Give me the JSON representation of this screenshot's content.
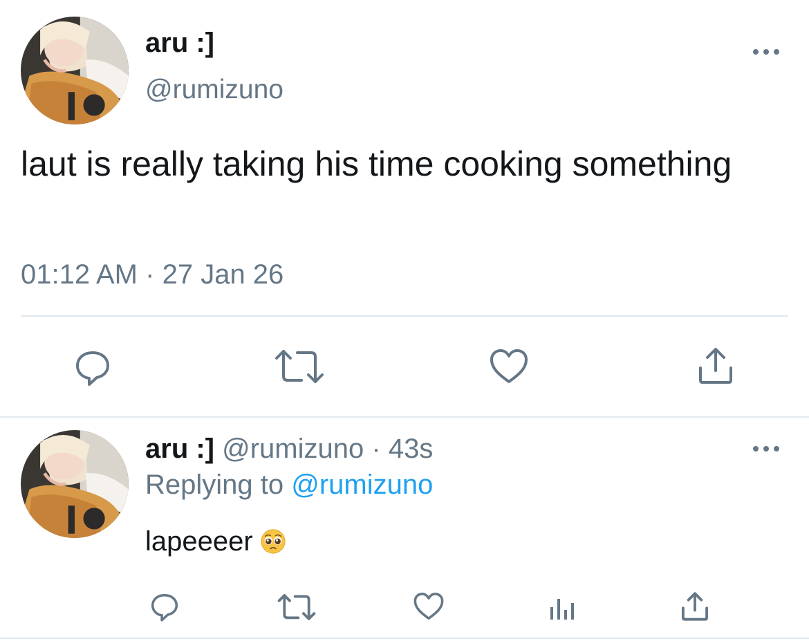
{
  "main_tweet": {
    "display_name": "aru :]",
    "handle": "@rumizuno",
    "text": "laut is really taking his time cooking something",
    "time": "01:12 AM",
    "separator": "·",
    "date": "27 Jan 26",
    "actions": [
      "reply-icon",
      "retweet-icon",
      "like-icon",
      "share-icon"
    ]
  },
  "reply_tweet": {
    "display_name": "aru :]",
    "handle": "@rumizuno",
    "separator": "·",
    "age": "43s",
    "replying_prefix": "Replying to",
    "replying_to": "@rumizuno",
    "text": "lapeeeer",
    "emoji": "pleading-face-emoji",
    "actions": [
      "reply-icon",
      "retweet-icon",
      "like-icon",
      "analytics-icon",
      "share-icon"
    ]
  },
  "colors": {
    "text_primary": "#14171a",
    "text_secondary": "#657786",
    "link": "#1da1f2",
    "divider": "#e1e8ed"
  }
}
